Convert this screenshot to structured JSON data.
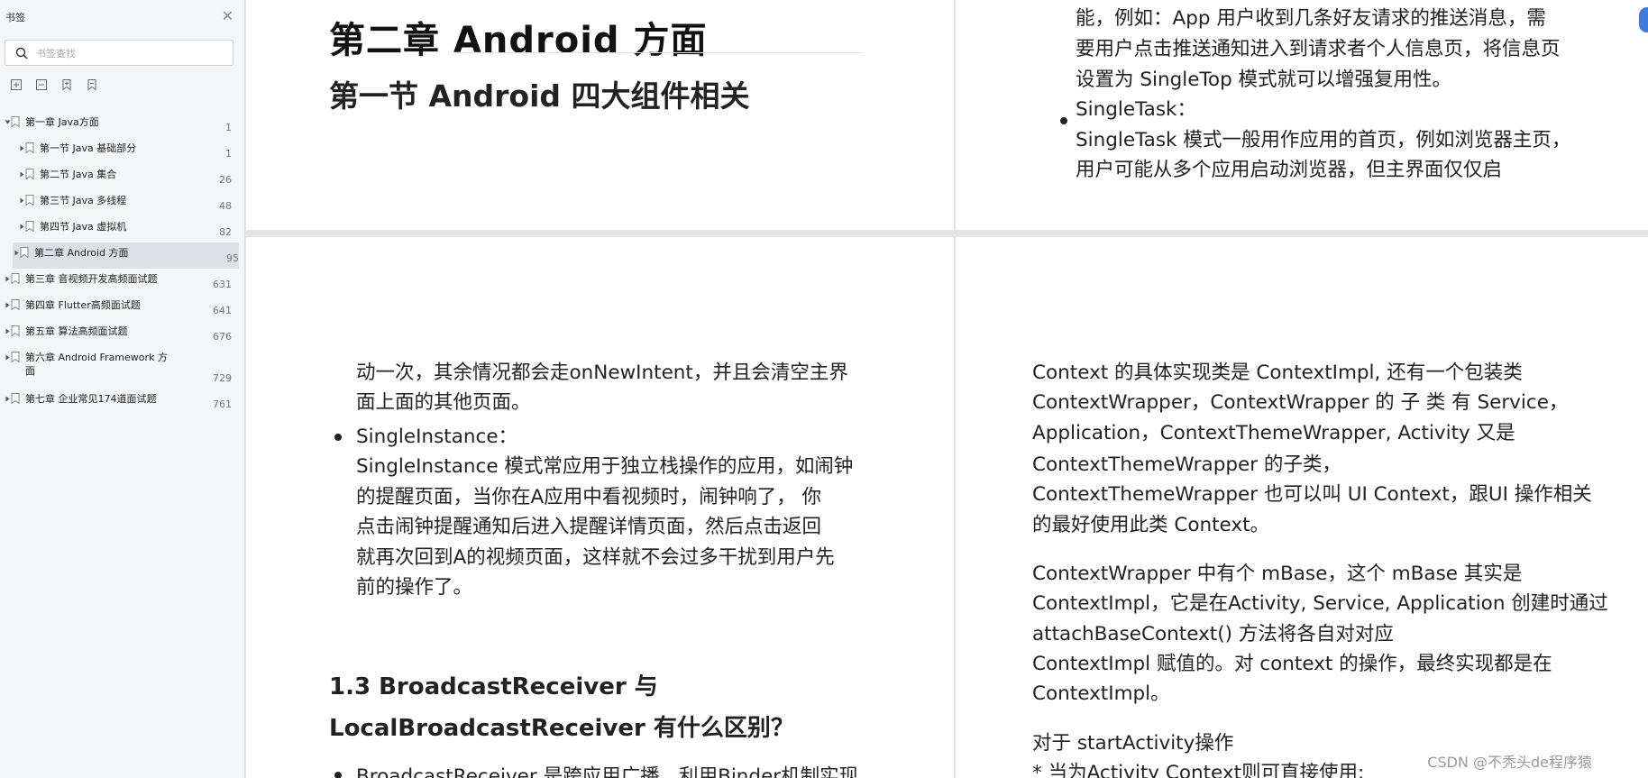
{
  "sidebar": {
    "title": "书签",
    "search_placeholder": "书签查找",
    "bookmarks": [
      {
        "label": "第一章 Java方面",
        "page": "1",
        "level": 0,
        "expanded": true
      },
      {
        "label": "第一节 Java 基础部分",
        "page": "1",
        "level": 1
      },
      {
        "label": "第二节 Java 集合",
        "page": "26",
        "level": 1
      },
      {
        "label": "第三节 Java 多线程",
        "page": "48",
        "level": 1
      },
      {
        "label": "第四节 Java 虚拟机",
        "page": "82",
        "level": 1
      },
      {
        "label": "第二章 Android 方面",
        "page": "95",
        "level": 0,
        "selected": true
      },
      {
        "label": "第三章 音视频开发高频面试题",
        "page": "631",
        "level": 0
      },
      {
        "label": "第四章 Flutter高频面试题",
        "page": "641",
        "level": 0
      },
      {
        "label": "第五章 算法高频面试题",
        "page": "676",
        "level": 0
      },
      {
        "label": "第六章 Android Framework 方面",
        "page": "729",
        "level": 0,
        "tall": true
      },
      {
        "label": "第七章 企业常见174道面试题",
        "page": "761",
        "level": 0
      }
    ]
  },
  "page1": {
    "chapter_title": "第二章   Android  方面",
    "section_title": "第一节  Android  四大组件相关"
  },
  "page2": {
    "lines": [
      "能，例如：App 用户收到几条好友请求的推送消息，需",
      "要用户点击推送通知进入到请求者个人信息页，将信息页",
      "设置为  SingleTop  模式就可以增强复用性。"
    ],
    "bullet_title": "SingleTask：",
    "bullet_lines": [
      "SingleTask   模式一般用作应用的首页，例如浏览器主页，",
      "用户可能从多个应用启动浏览器，但主界面仅仅启"
    ]
  },
  "page3": {
    "lines": [
      "动一次，其余情况都会走onNewIntent，并且会清空主界",
      "面上面的其他页面。"
    ],
    "bullet_title": "SingleInstance：",
    "bullet_lines": [
      "SingleInstance  模式常应用于独立栈操作的应用，如闹钟",
      "的提醒页面，当你在A应用中看视频时，闹钟响了，  你",
      "点击闹钟提醒通知后进入提醒详情页面，然后点击返回",
      "就再次回到A的视频页面，这样就不会过多干扰到用户先",
      "前的操作了。"
    ],
    "heading_lines": [
      "1.3 BroadcastReceiver  与",
      "LocalBroadcastReceiver  有什么区别？"
    ],
    "partial_line": "BroadcastReceiver   是跨应用广播，利用Binder机制实现，"
  },
  "page4": {
    "para1": [
      "Context 的具体实现类是  ContextImpl, 还有一个包装类",
      "ContextWrapper，ContextWrapper  的 子 类 有    Service，",
      "Application，ContextThemeWrapper, Activity 又是",
      "ContextThemeWrapper  的子类，",
      "ContextThemeWrapper  也可以叫  UI Context，跟UI  操作相关",
      "的最好使用此类  Context。"
    ],
    "para2": [
      "ContextWrapper 中有个  mBase，这个  mBase 其实是",
      "ContextImpl，它是在Activity, Service, Application   创建时通过",
      "attachBaseContext() 方法将各自对对应",
      "ContextImpl  赋值的。对  context  的操作，最终实现都是在",
      "ContextImpl。"
    ],
    "para3": "对于  startActivity操作",
    "partial_line": "* 当为Activity Context则可直接使用;"
  },
  "watermark": "CSDN @不秃头de程序猿",
  "colors": {
    "sidebar_bg": "#f5f6f7",
    "selected_bg": "#dde0e5",
    "page_bg": "#ffffff",
    "gap_bg": "#e4e4e4",
    "page_number": "#6b7b8c",
    "accent": "#3c7ce0"
  }
}
